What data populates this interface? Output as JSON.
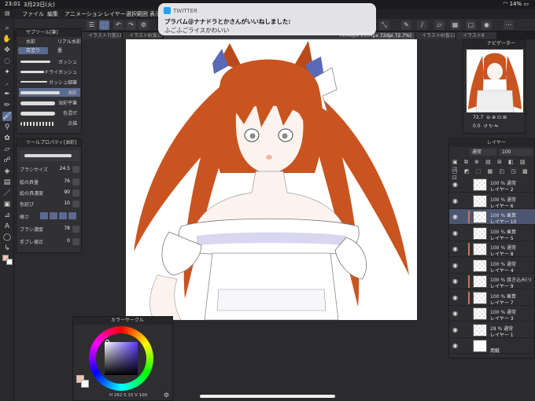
{
  "status": {
    "time": "23:01",
    "date": "3月23日(火)",
    "battery": "14%"
  },
  "menu": [
    "ファイル",
    "編集",
    "アニメーション",
    "レイヤー",
    "選択範囲",
    "表示"
  ],
  "tabs": [
    "イラスト7(仮1)",
    "イラスト8(仮1)",
    "(4048px 2304px 72dpi 72.7%)",
    "イラスト6(仮1)",
    "イラスト8"
  ],
  "notification": {
    "app": "TWITTER",
    "title": "プラバム@ナナドラとかさんがいいねしました:",
    "body": "ふごふごライスかわいい"
  },
  "subtool": {
    "header": "サブツール[筆]",
    "groups": [
      "水彩",
      "リアル水彩",
      "厚塗り",
      "墨"
    ],
    "brushes": [
      "ガッシュ",
      "ドライガッシュ",
      "ガッシュ細筆",
      "油彩",
      "油彩平筆",
      "色混ぜ",
      "点描"
    ],
    "active_brush": "油彩"
  },
  "tool_property": {
    "header": "ツールプロパティ[油彩]",
    "props": [
      {
        "label": "ブラシサイズ",
        "value": "24.5"
      },
      {
        "label": "絵の具量",
        "value": "76"
      },
      {
        "label": "絵の具濃度",
        "value": "90"
      },
      {
        "label": "色延び",
        "value": "10"
      },
      {
        "label": "硬さ",
        "value": ""
      },
      {
        "label": "ブラシ濃度",
        "value": "78"
      },
      {
        "label": "手ブレ補正",
        "value": "0"
      }
    ]
  },
  "colorwheel": {
    "header": "カラーサークル",
    "readout": "H 262  S 15  V 100",
    "main_color": "#f2c3b0",
    "sub_color": "#ffffff"
  },
  "navigator": {
    "header": "ナビゲーター",
    "zoom": "72.7",
    "angle": "0.0"
  },
  "layer_panel": {
    "header": "レイヤー",
    "blend": "通常",
    "opacity": "100",
    "layers": [
      {
        "opacity": "100 %",
        "mode": "通常",
        "name": "レイヤー 2",
        "selected": false,
        "clip": false
      },
      {
        "opacity": "100 %",
        "mode": "通常",
        "name": "レイヤー 6",
        "selected": false,
        "clip": false
      },
      {
        "opacity": "100 %",
        "mode": "乗算",
        "name": "レイヤー 10",
        "selected": true,
        "clip": true
      },
      {
        "opacity": "100 %",
        "mode": "乗算",
        "name": "レイヤー 5",
        "selected": false,
        "clip": false
      },
      {
        "opacity": "100 %",
        "mode": "通常",
        "name": "レイヤー 8",
        "selected": false,
        "clip": true
      },
      {
        "opacity": "100 %",
        "mode": "通常",
        "name": "レイヤー 4",
        "selected": false,
        "clip": false
      },
      {
        "opacity": "100 %",
        "mode": "焼き込み(リ",
        "name": "レイヤー 9",
        "selected": false,
        "clip": true
      },
      {
        "opacity": "100 %",
        "mode": "乗算",
        "name": "レイヤー 7",
        "selected": false,
        "clip": true
      },
      {
        "opacity": "100 %",
        "mode": "通常",
        "name": "レイヤー 3",
        "selected": false,
        "clip": false
      },
      {
        "opacity": "28 %",
        "mode": "通常",
        "name": "レイヤー 1",
        "selected": false,
        "clip": false
      },
      {
        "opacity": "",
        "mode": "",
        "name": "用紙",
        "selected": false,
        "clip": false
      }
    ]
  },
  "colors": {
    "hair": "#c9541f",
    "ribbon": "#5a6ab8",
    "accent": "#5b6a90"
  }
}
